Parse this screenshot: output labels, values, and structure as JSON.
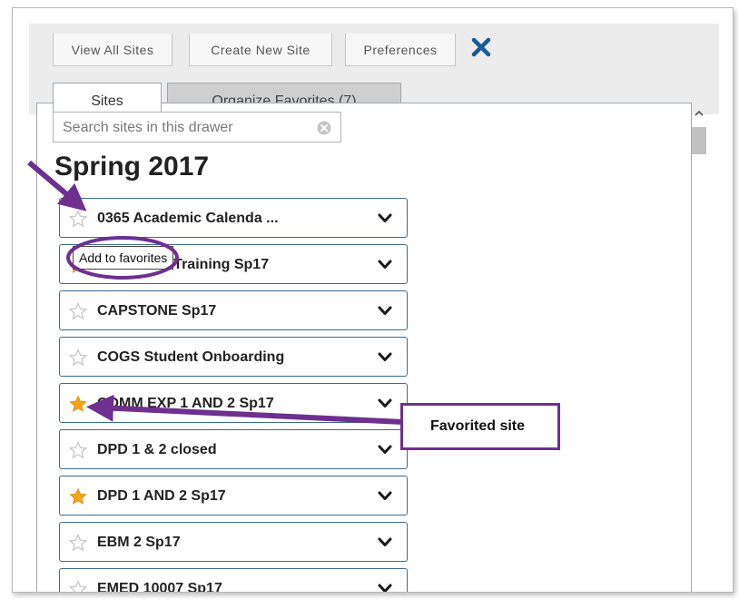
{
  "toolbar": {
    "view_all_sites": "View All Sites",
    "create_new_site": "Create New Site",
    "preferences": "Preferences",
    "close_icon": "close-x-icon"
  },
  "tabs": [
    {
      "label": "Sites",
      "active": true
    },
    {
      "label": "Organize Favorites (7)",
      "active": false
    }
  ],
  "search": {
    "placeholder": "Search sites in this drawer",
    "value": ""
  },
  "term": "Spring 2017",
  "sites": [
    {
      "name": "0365 Academic Calenda ...",
      "favorite": false
    },
    {
      "name": "Acad Tech Training Sp17",
      "favorite": true
    },
    {
      "name": "CAPSTONE Sp17",
      "favorite": false
    },
    {
      "name": "COGS Student Onboarding",
      "favorite": false
    },
    {
      "name": "COMM EXP 1 AND 2 Sp17",
      "favorite": true
    },
    {
      "name": "DPD 1 & 2 closed",
      "favorite": false
    },
    {
      "name": "DPD 1 AND 2 Sp17",
      "favorite": true
    },
    {
      "name": "EBM 2 Sp17",
      "favorite": false
    },
    {
      "name": "EMED 10007 Sp17",
      "favorite": false
    }
  ],
  "tooltip": "Add to favorites",
  "callout": "Favorited site",
  "colors": {
    "accent_blue": "#1a5a9a",
    "row_border": "#3e6b8f",
    "star_favorite": "#f5a31a",
    "star_empty": "#c8c8c8",
    "annotation_purple": "#6e2f8f",
    "toolbar_bg": "#ececec"
  }
}
